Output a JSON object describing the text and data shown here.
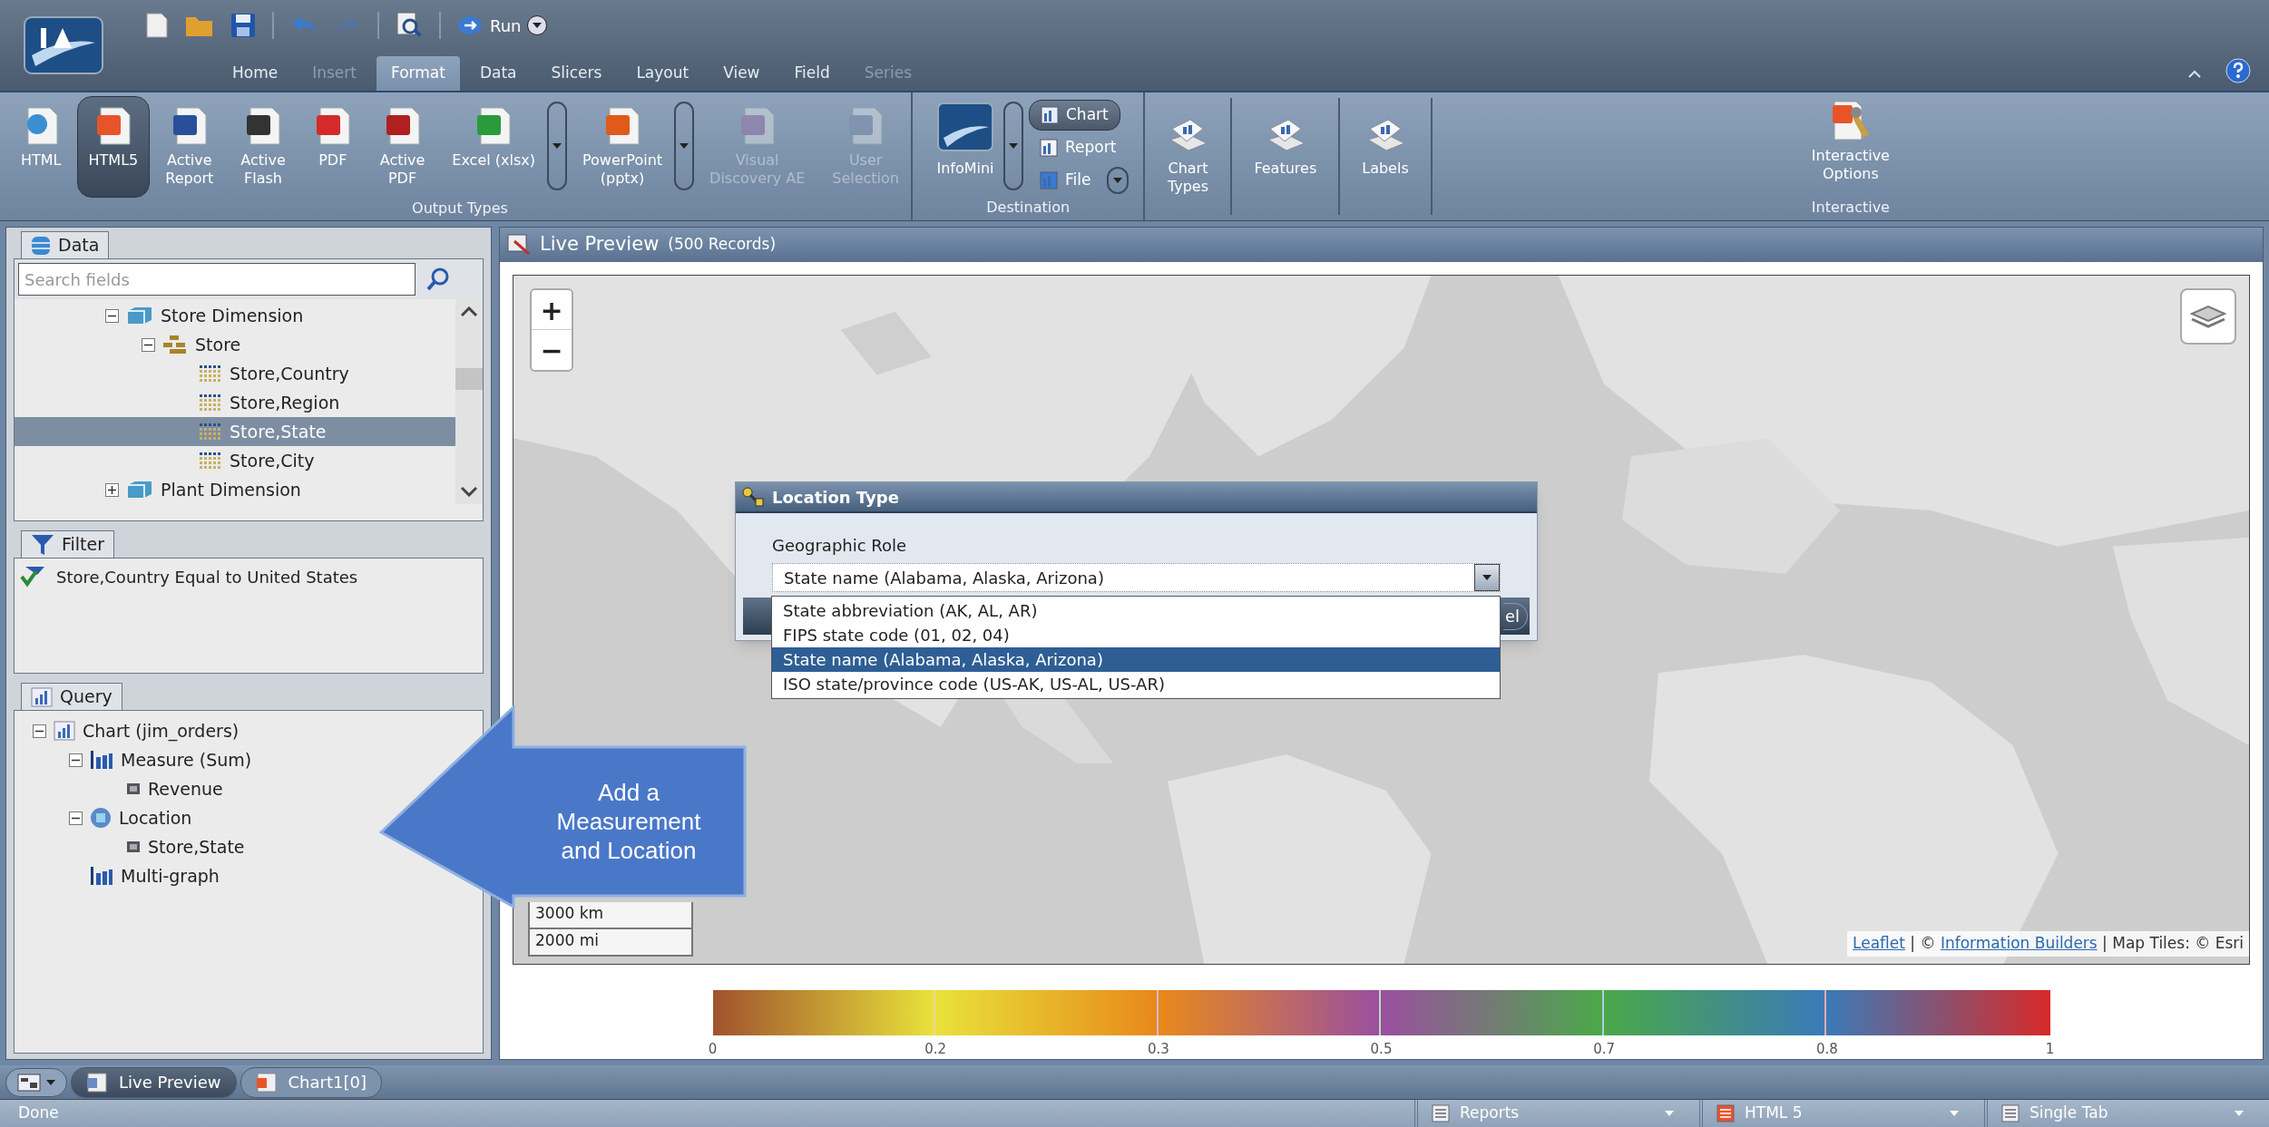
{
  "toolbar": {
    "run": "Run"
  },
  "menu_tabs": [
    {
      "label": "Home",
      "selected": false,
      "disabled": false
    },
    {
      "label": "Insert",
      "selected": false,
      "disabled": true
    },
    {
      "label": "Format",
      "selected": true,
      "disabled": false
    },
    {
      "label": "Data",
      "selected": false,
      "disabled": false
    },
    {
      "label": "Slicers",
      "selected": false,
      "disabled": false
    },
    {
      "label": "Layout",
      "selected": false,
      "disabled": false
    },
    {
      "label": "View",
      "selected": false,
      "disabled": false
    },
    {
      "label": "Field",
      "selected": false,
      "disabled": false
    },
    {
      "label": "Series",
      "selected": false,
      "disabled": true
    }
  ],
  "ribbon": {
    "output_types": {
      "label": "Output Types",
      "items": [
        {
          "label": "HTML",
          "selected": false,
          "disabled": false,
          "dropdown": false
        },
        {
          "label": "HTML5",
          "selected": true,
          "disabled": false,
          "dropdown": false
        },
        {
          "label": "Active\nReport",
          "selected": false,
          "disabled": false,
          "dropdown": false
        },
        {
          "label": "Active\nFlash",
          "selected": false,
          "disabled": false,
          "dropdown": false
        },
        {
          "label": "PDF",
          "selected": false,
          "disabled": false,
          "dropdown": false
        },
        {
          "label": "Active\nPDF",
          "selected": false,
          "disabled": false,
          "dropdown": false
        },
        {
          "label": "Excel (xlsx)",
          "selected": false,
          "disabled": false,
          "dropdown": true
        },
        {
          "label": "PowerPoint\n(pptx)",
          "selected": false,
          "disabled": false,
          "dropdown": true
        },
        {
          "label": "Visual\nDiscovery AE",
          "selected": false,
          "disabled": true,
          "dropdown": false
        },
        {
          "label": "User\nSelection",
          "selected": false,
          "disabled": true,
          "dropdown": false
        }
      ]
    },
    "destination": {
      "label": "Destination",
      "main": {
        "label": "InfoMini"
      },
      "options": [
        {
          "label": "Chart",
          "selected": true,
          "dropdown": false
        },
        {
          "label": "Report",
          "selected": false,
          "dropdown": false
        },
        {
          "label": "File",
          "selected": false,
          "dropdown": true
        }
      ]
    },
    "tools": [
      {
        "label": "Chart\nTypes"
      },
      {
        "label": "Features"
      },
      {
        "label": "Labels"
      }
    ],
    "interactive": {
      "label": "Interactive",
      "items": [
        {
          "label": "Interactive\nOptions"
        }
      ]
    }
  },
  "data_panel": {
    "title": "Data",
    "search": {
      "placeholder": "Search fields"
    },
    "tree": [
      {
        "label": "Store Dimension",
        "kind": "dimension",
        "expanded": true,
        "selected": false,
        "children": [
          {
            "label": "Store",
            "kind": "hierarchy",
            "expanded": true,
            "selected": false,
            "children": [
              {
                "label": "Store,Country",
                "kind": "field",
                "selected": false
              },
              {
                "label": "Store,Region",
                "kind": "field",
                "selected": false
              },
              {
                "label": "Store,State",
                "kind": "field",
                "selected": true
              },
              {
                "label": "Store,City",
                "kind": "field",
                "selected": false
              }
            ]
          }
        ]
      },
      {
        "label": "Plant Dimension",
        "kind": "dimension",
        "expanded": false,
        "selected": false
      }
    ]
  },
  "filter_panel": {
    "title": "Filter",
    "items": [
      "Store,Country Equal to United States"
    ]
  },
  "query_panel": {
    "title": "Query",
    "tree": [
      {
        "label": "Chart (jim_orders)",
        "kind": "chart",
        "expanded": true,
        "children": [
          {
            "label": "Measure (Sum)",
            "kind": "measure",
            "expanded": true,
            "children": [
              {
                "label": "Revenue",
                "kind": "value"
              }
            ]
          },
          {
            "label": "Location",
            "kind": "location",
            "expanded": true,
            "children": [
              {
                "label": "Store,State",
                "kind": "value"
              }
            ]
          },
          {
            "label": "Multi-graph",
            "kind": "measure"
          }
        ]
      }
    ]
  },
  "preview": {
    "title": "Live Preview",
    "records": "(500 Records)",
    "map": {
      "zoom_in": "+",
      "zoom_out": "−",
      "scale": [
        "3000 km",
        "2000 mi"
      ],
      "attribution": [
        {
          "text": "Leaflet",
          "link": true
        },
        {
          "text": " | © ",
          "link": false
        },
        {
          "text": "Information Builders",
          "link": true
        },
        {
          "text": " | Map Tiles: © Esri",
          "link": false
        }
      ]
    },
    "legend": {
      "stops": [
        {
          "label": "0",
          "color": "#a0522d"
        },
        {
          "label": "0.2",
          "color": "#e8e23a"
        },
        {
          "label": "0.3",
          "color": "#e8891a"
        },
        {
          "label": "0.5",
          "color": "#9b4f9f"
        },
        {
          "label": "0.7",
          "color": "#4aa84a"
        },
        {
          "label": "0.8",
          "color": "#3a7ab8"
        },
        {
          "label": "1",
          "color": "#d62a2a"
        }
      ]
    }
  },
  "dialog": {
    "title": "Location Type",
    "field_label": "Geographic Role",
    "value": "State name (Alabama, Alaska, Arizona)",
    "button": "el",
    "options": [
      {
        "label": "State abbreviation (AK, AL, AR)",
        "selected": false
      },
      {
        "label": "FIPS state code (01, 02, 04)",
        "selected": false
      },
      {
        "label": "State name (Alabama, Alaska, Arizona)",
        "selected": true
      },
      {
        "label": "ISO state/province code (US-AK, US-AL, US-AR)",
        "selected": false
      }
    ]
  },
  "callout": {
    "text": "Add a\nMeasurement\nand Location"
  },
  "bottom_tabs": [
    {
      "label": "Live Preview",
      "selected": true
    },
    {
      "label": "Chart1[0]",
      "selected": false
    }
  ],
  "status_bar": {
    "text": "Done",
    "dropdowns": [
      "Reports",
      "HTML 5",
      "Single Tab"
    ]
  }
}
